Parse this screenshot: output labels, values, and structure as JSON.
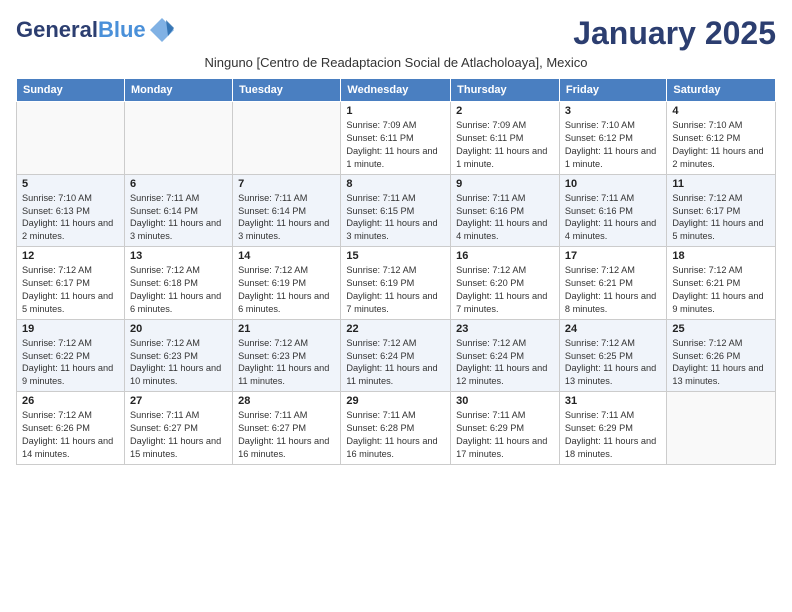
{
  "header": {
    "logo_general": "General",
    "logo_blue": "Blue",
    "month_title": "January 2025",
    "subtitle": "Ninguno [Centro de Readaptacion Social de Atlacholoaya], Mexico"
  },
  "days_of_week": [
    "Sunday",
    "Monday",
    "Tuesday",
    "Wednesday",
    "Thursday",
    "Friday",
    "Saturday"
  ],
  "weeks": [
    [
      {
        "day": "",
        "info": ""
      },
      {
        "day": "",
        "info": ""
      },
      {
        "day": "",
        "info": ""
      },
      {
        "day": "1",
        "info": "Sunrise: 7:09 AM\nSunset: 6:11 PM\nDaylight: 11 hours and 1 minute."
      },
      {
        "day": "2",
        "info": "Sunrise: 7:09 AM\nSunset: 6:11 PM\nDaylight: 11 hours and 1 minute."
      },
      {
        "day": "3",
        "info": "Sunrise: 7:10 AM\nSunset: 6:12 PM\nDaylight: 11 hours and 1 minute."
      },
      {
        "day": "4",
        "info": "Sunrise: 7:10 AM\nSunset: 6:12 PM\nDaylight: 11 hours and 2 minutes."
      }
    ],
    [
      {
        "day": "5",
        "info": "Sunrise: 7:10 AM\nSunset: 6:13 PM\nDaylight: 11 hours and 2 minutes."
      },
      {
        "day": "6",
        "info": "Sunrise: 7:11 AM\nSunset: 6:14 PM\nDaylight: 11 hours and 3 minutes."
      },
      {
        "day": "7",
        "info": "Sunrise: 7:11 AM\nSunset: 6:14 PM\nDaylight: 11 hours and 3 minutes."
      },
      {
        "day": "8",
        "info": "Sunrise: 7:11 AM\nSunset: 6:15 PM\nDaylight: 11 hours and 3 minutes."
      },
      {
        "day": "9",
        "info": "Sunrise: 7:11 AM\nSunset: 6:16 PM\nDaylight: 11 hours and 4 minutes."
      },
      {
        "day": "10",
        "info": "Sunrise: 7:11 AM\nSunset: 6:16 PM\nDaylight: 11 hours and 4 minutes."
      },
      {
        "day": "11",
        "info": "Sunrise: 7:12 AM\nSunset: 6:17 PM\nDaylight: 11 hours and 5 minutes."
      }
    ],
    [
      {
        "day": "12",
        "info": "Sunrise: 7:12 AM\nSunset: 6:17 PM\nDaylight: 11 hours and 5 minutes."
      },
      {
        "day": "13",
        "info": "Sunrise: 7:12 AM\nSunset: 6:18 PM\nDaylight: 11 hours and 6 minutes."
      },
      {
        "day": "14",
        "info": "Sunrise: 7:12 AM\nSunset: 6:19 PM\nDaylight: 11 hours and 6 minutes."
      },
      {
        "day": "15",
        "info": "Sunrise: 7:12 AM\nSunset: 6:19 PM\nDaylight: 11 hours and 7 minutes."
      },
      {
        "day": "16",
        "info": "Sunrise: 7:12 AM\nSunset: 6:20 PM\nDaylight: 11 hours and 7 minutes."
      },
      {
        "day": "17",
        "info": "Sunrise: 7:12 AM\nSunset: 6:21 PM\nDaylight: 11 hours and 8 minutes."
      },
      {
        "day": "18",
        "info": "Sunrise: 7:12 AM\nSunset: 6:21 PM\nDaylight: 11 hours and 9 minutes."
      }
    ],
    [
      {
        "day": "19",
        "info": "Sunrise: 7:12 AM\nSunset: 6:22 PM\nDaylight: 11 hours and 9 minutes."
      },
      {
        "day": "20",
        "info": "Sunrise: 7:12 AM\nSunset: 6:23 PM\nDaylight: 11 hours and 10 minutes."
      },
      {
        "day": "21",
        "info": "Sunrise: 7:12 AM\nSunset: 6:23 PM\nDaylight: 11 hours and 11 minutes."
      },
      {
        "day": "22",
        "info": "Sunrise: 7:12 AM\nSunset: 6:24 PM\nDaylight: 11 hours and 11 minutes."
      },
      {
        "day": "23",
        "info": "Sunrise: 7:12 AM\nSunset: 6:24 PM\nDaylight: 11 hours and 12 minutes."
      },
      {
        "day": "24",
        "info": "Sunrise: 7:12 AM\nSunset: 6:25 PM\nDaylight: 11 hours and 13 minutes."
      },
      {
        "day": "25",
        "info": "Sunrise: 7:12 AM\nSunset: 6:26 PM\nDaylight: 11 hours and 13 minutes."
      }
    ],
    [
      {
        "day": "26",
        "info": "Sunrise: 7:12 AM\nSunset: 6:26 PM\nDaylight: 11 hours and 14 minutes."
      },
      {
        "day": "27",
        "info": "Sunrise: 7:11 AM\nSunset: 6:27 PM\nDaylight: 11 hours and 15 minutes."
      },
      {
        "day": "28",
        "info": "Sunrise: 7:11 AM\nSunset: 6:27 PM\nDaylight: 11 hours and 16 minutes."
      },
      {
        "day": "29",
        "info": "Sunrise: 7:11 AM\nSunset: 6:28 PM\nDaylight: 11 hours and 16 minutes."
      },
      {
        "day": "30",
        "info": "Sunrise: 7:11 AM\nSunset: 6:29 PM\nDaylight: 11 hours and 17 minutes."
      },
      {
        "day": "31",
        "info": "Sunrise: 7:11 AM\nSunset: 6:29 PM\nDaylight: 11 hours and 18 minutes."
      },
      {
        "day": "",
        "info": ""
      }
    ]
  ]
}
